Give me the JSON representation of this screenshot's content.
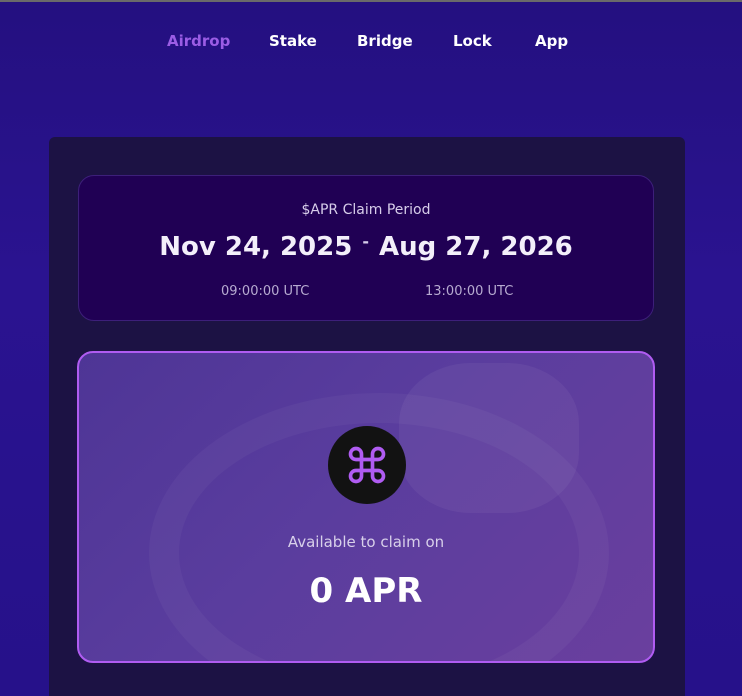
{
  "nav": {
    "items": [
      {
        "label": "Airdrop",
        "active": true
      },
      {
        "label": "Stake",
        "active": false
      },
      {
        "label": "Bridge",
        "active": false
      },
      {
        "label": "Lock",
        "active": false
      },
      {
        "label": "App",
        "active": false
      }
    ]
  },
  "period": {
    "title": "$APR Claim Period",
    "start_date": "Nov 24, 2025",
    "separator": "-",
    "end_date": "Aug 27, 2026",
    "start_time": "09:00:00 UTC",
    "end_time": "13:00:00 UTC"
  },
  "claim": {
    "icon": "command-icon",
    "label": "Available to claim on",
    "amount": "0 APR"
  },
  "colors": {
    "accent": "#9b5de5",
    "claim_border": "#b05cf2",
    "background": "#26118a"
  }
}
